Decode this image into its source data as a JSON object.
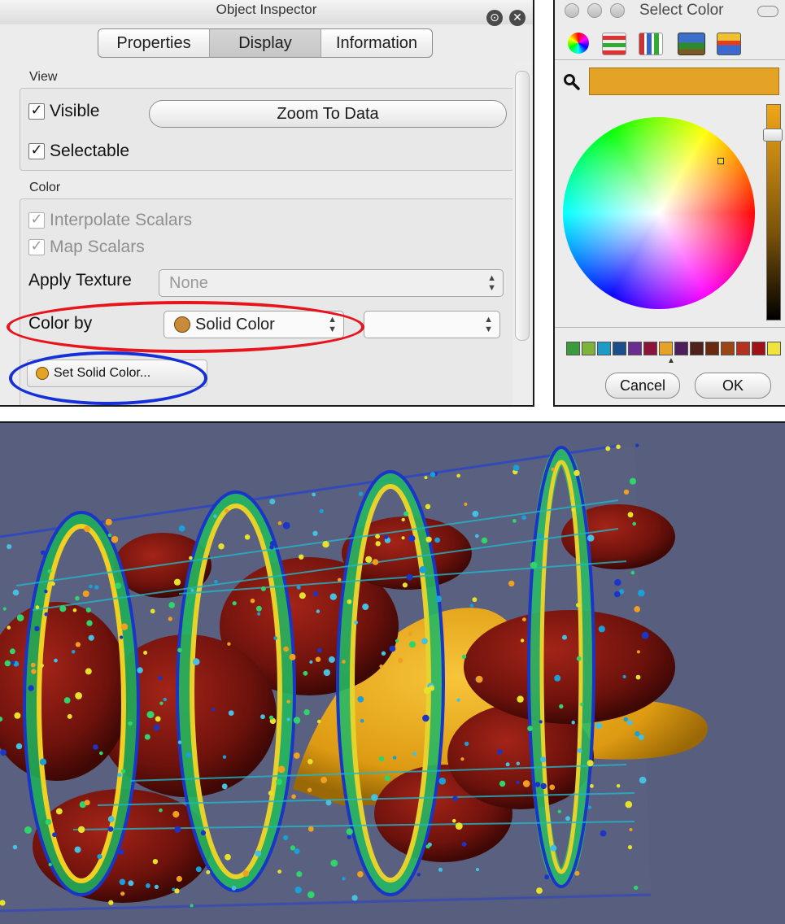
{
  "inspector": {
    "title": "Object Inspector",
    "tabs": [
      {
        "label": "Properties",
        "active": false
      },
      {
        "label": "Display",
        "active": true
      },
      {
        "label": "Information",
        "active": false
      }
    ],
    "view_group": {
      "label": "View",
      "visible": {
        "label": "Visible",
        "checked": true
      },
      "selectable": {
        "label": "Selectable",
        "checked": true
      },
      "zoom_button": "Zoom To Data"
    },
    "color_group": {
      "label": "Color",
      "interpolate": {
        "label": "Interpolate Scalars",
        "checked": true,
        "enabled": false
      },
      "map_scalars": {
        "label": "Map Scalars",
        "checked": true,
        "enabled": false
      },
      "apply_texture": {
        "label": "Apply Texture",
        "value": "None"
      },
      "color_by": {
        "label": "Color by",
        "value": "Solid Color",
        "component_value": ""
      },
      "set_solid_color": "Set Solid Color..."
    },
    "highlights": {
      "color_by": "#e8141c",
      "set_solid_color": "#1530d8"
    }
  },
  "color_picker": {
    "title": "Select Color",
    "selected_color": "#e4a326",
    "mode_icons": [
      "color-wheel-icon",
      "sliders-icon",
      "palettes-icon",
      "image-palette-icon",
      "crayons-icon"
    ],
    "palette": [
      "#3a9a3c",
      "#7fb23a",
      "#1c9bc9",
      "#1a4f8c",
      "#6b2d8f",
      "#8b1538",
      "#e4a326",
      "#4d1d5c",
      "#50211a",
      "#6a2a10",
      "#9b4617",
      "#b5311f",
      "#a01017",
      "#f0e33a"
    ],
    "cancel": "Cancel",
    "ok": "OK"
  },
  "render_view": {
    "background": "#585e7e",
    "description_colors": {
      "solid_color": "#e4a326",
      "dark_surface": "#7a1410"
    }
  }
}
